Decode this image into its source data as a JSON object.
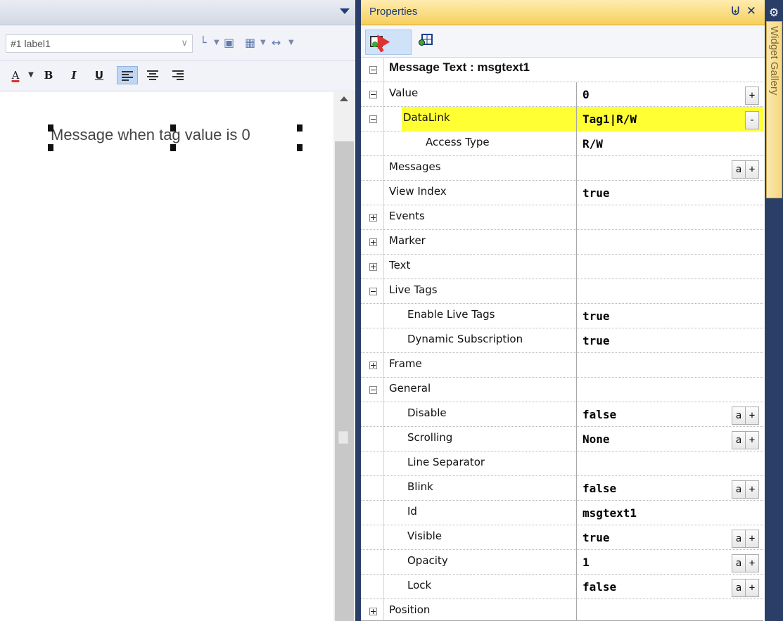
{
  "editor": {
    "object_selector": "#1 label1",
    "format": {
      "font_color_label": "A",
      "bold_label": "B",
      "italic_label": "I",
      "underline_label": "U"
    },
    "canvas_text": "Message when tag value is 0"
  },
  "properties": {
    "title": "Properties",
    "pin_glyph": "⨄",
    "close_glyph": "✕",
    "rows": [
      {
        "name": "Message Text : msgtext1",
        "value": "",
        "toggle": "minus",
        "indent": 0,
        "header": true
      },
      {
        "name": "Value",
        "value": "0",
        "toggle": "minus",
        "indent": 0,
        "buttons": [
          "+"
        ]
      },
      {
        "name": "DataLink",
        "value": "Tag1|R/W",
        "toggle": "minus",
        "indent": 2,
        "highlight": true,
        "buttons": [
          "-"
        ]
      },
      {
        "name": "Access Type",
        "value": "R/W",
        "indent": 3
      },
      {
        "name": "Messages",
        "value": "",
        "indent": 1,
        "buttons": [
          "a",
          "+"
        ]
      },
      {
        "name": "View Index",
        "value": "true",
        "indent": 1
      },
      {
        "name": "Events",
        "value": "",
        "toggle": "plus",
        "indent": 0
      },
      {
        "name": "Marker",
        "value": "",
        "toggle": "plus",
        "indent": 0
      },
      {
        "name": "Text",
        "value": "",
        "toggle": "plus",
        "indent": 0
      },
      {
        "name": "Live Tags",
        "value": "",
        "toggle": "minus",
        "indent": 0
      },
      {
        "name": "Enable Live Tags",
        "value": "true",
        "indent": 2
      },
      {
        "name": "Dynamic Subscription",
        "value": "true",
        "indent": 2
      },
      {
        "name": "Frame",
        "value": "",
        "toggle": "plus",
        "indent": 0
      },
      {
        "name": "General",
        "value": "",
        "toggle": "minus",
        "indent": 0
      },
      {
        "name": "Disable",
        "value": "false",
        "indent": 2,
        "buttons": [
          "a",
          "+"
        ]
      },
      {
        "name": "Scrolling",
        "value": "None",
        "indent": 2,
        "buttons": [
          "a",
          "+"
        ]
      },
      {
        "name": "Line Separator",
        "value": "",
        "indent": 2
      },
      {
        "name": "Blink",
        "value": "false",
        "indent": 2,
        "buttons": [
          "a",
          "+"
        ]
      },
      {
        "name": "Id",
        "value": "msgtext1",
        "indent": 2
      },
      {
        "name": "Visible",
        "value": "true",
        "indent": 2,
        "buttons": [
          "a",
          "+"
        ]
      },
      {
        "name": "Opacity",
        "value": "1",
        "indent": 2,
        "buttons": [
          "a",
          "+"
        ]
      },
      {
        "name": "Lock",
        "value": "false",
        "indent": 2,
        "buttons": [
          "a",
          "+"
        ]
      },
      {
        "name": "Position",
        "value": "",
        "toggle": "plus",
        "indent": 0
      }
    ]
  },
  "side_tab": {
    "label": "Widget Gallery"
  },
  "colors": {
    "highlight": "#ffff33",
    "title_bar": "#f6cf5c",
    "dark_frame": "#2a3e67"
  }
}
